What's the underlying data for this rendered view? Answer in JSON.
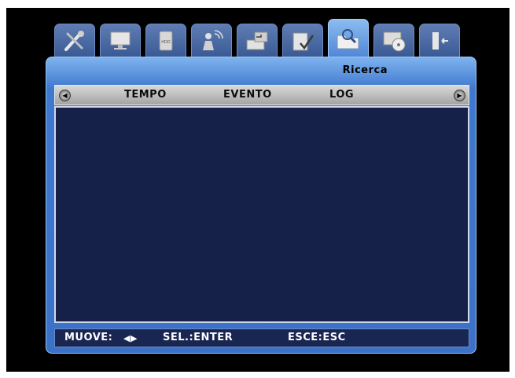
{
  "tabs": [
    {
      "icon": "tools-icon"
    },
    {
      "icon": "monitor-icon"
    },
    {
      "icon": "hdd-icon",
      "text": "HDD"
    },
    {
      "icon": "network-user-icon"
    },
    {
      "icon": "schedule-icon"
    },
    {
      "icon": "event-check-icon"
    },
    {
      "icon": "search-folder-icon",
      "active": true
    },
    {
      "icon": "backup-disc-icon"
    },
    {
      "icon": "exit-door-icon"
    }
  ],
  "panel": {
    "title": "Ricerca"
  },
  "subtabs": {
    "left_arrow": "◀",
    "right_arrow": "▶",
    "items": [
      "TEMPO",
      "EVENTO",
      "LOG"
    ]
  },
  "footer": {
    "move_label": "MUOVE:",
    "move_arrows": "◀▶",
    "select": "SEL.:ENTER",
    "exit": "ESCE:ESC"
  },
  "colors": {
    "background": "#000000",
    "panel": "#3b72c8",
    "content": "#16214a",
    "subbar": "#b8b8b8",
    "active_tab": "#6aa4e8"
  }
}
